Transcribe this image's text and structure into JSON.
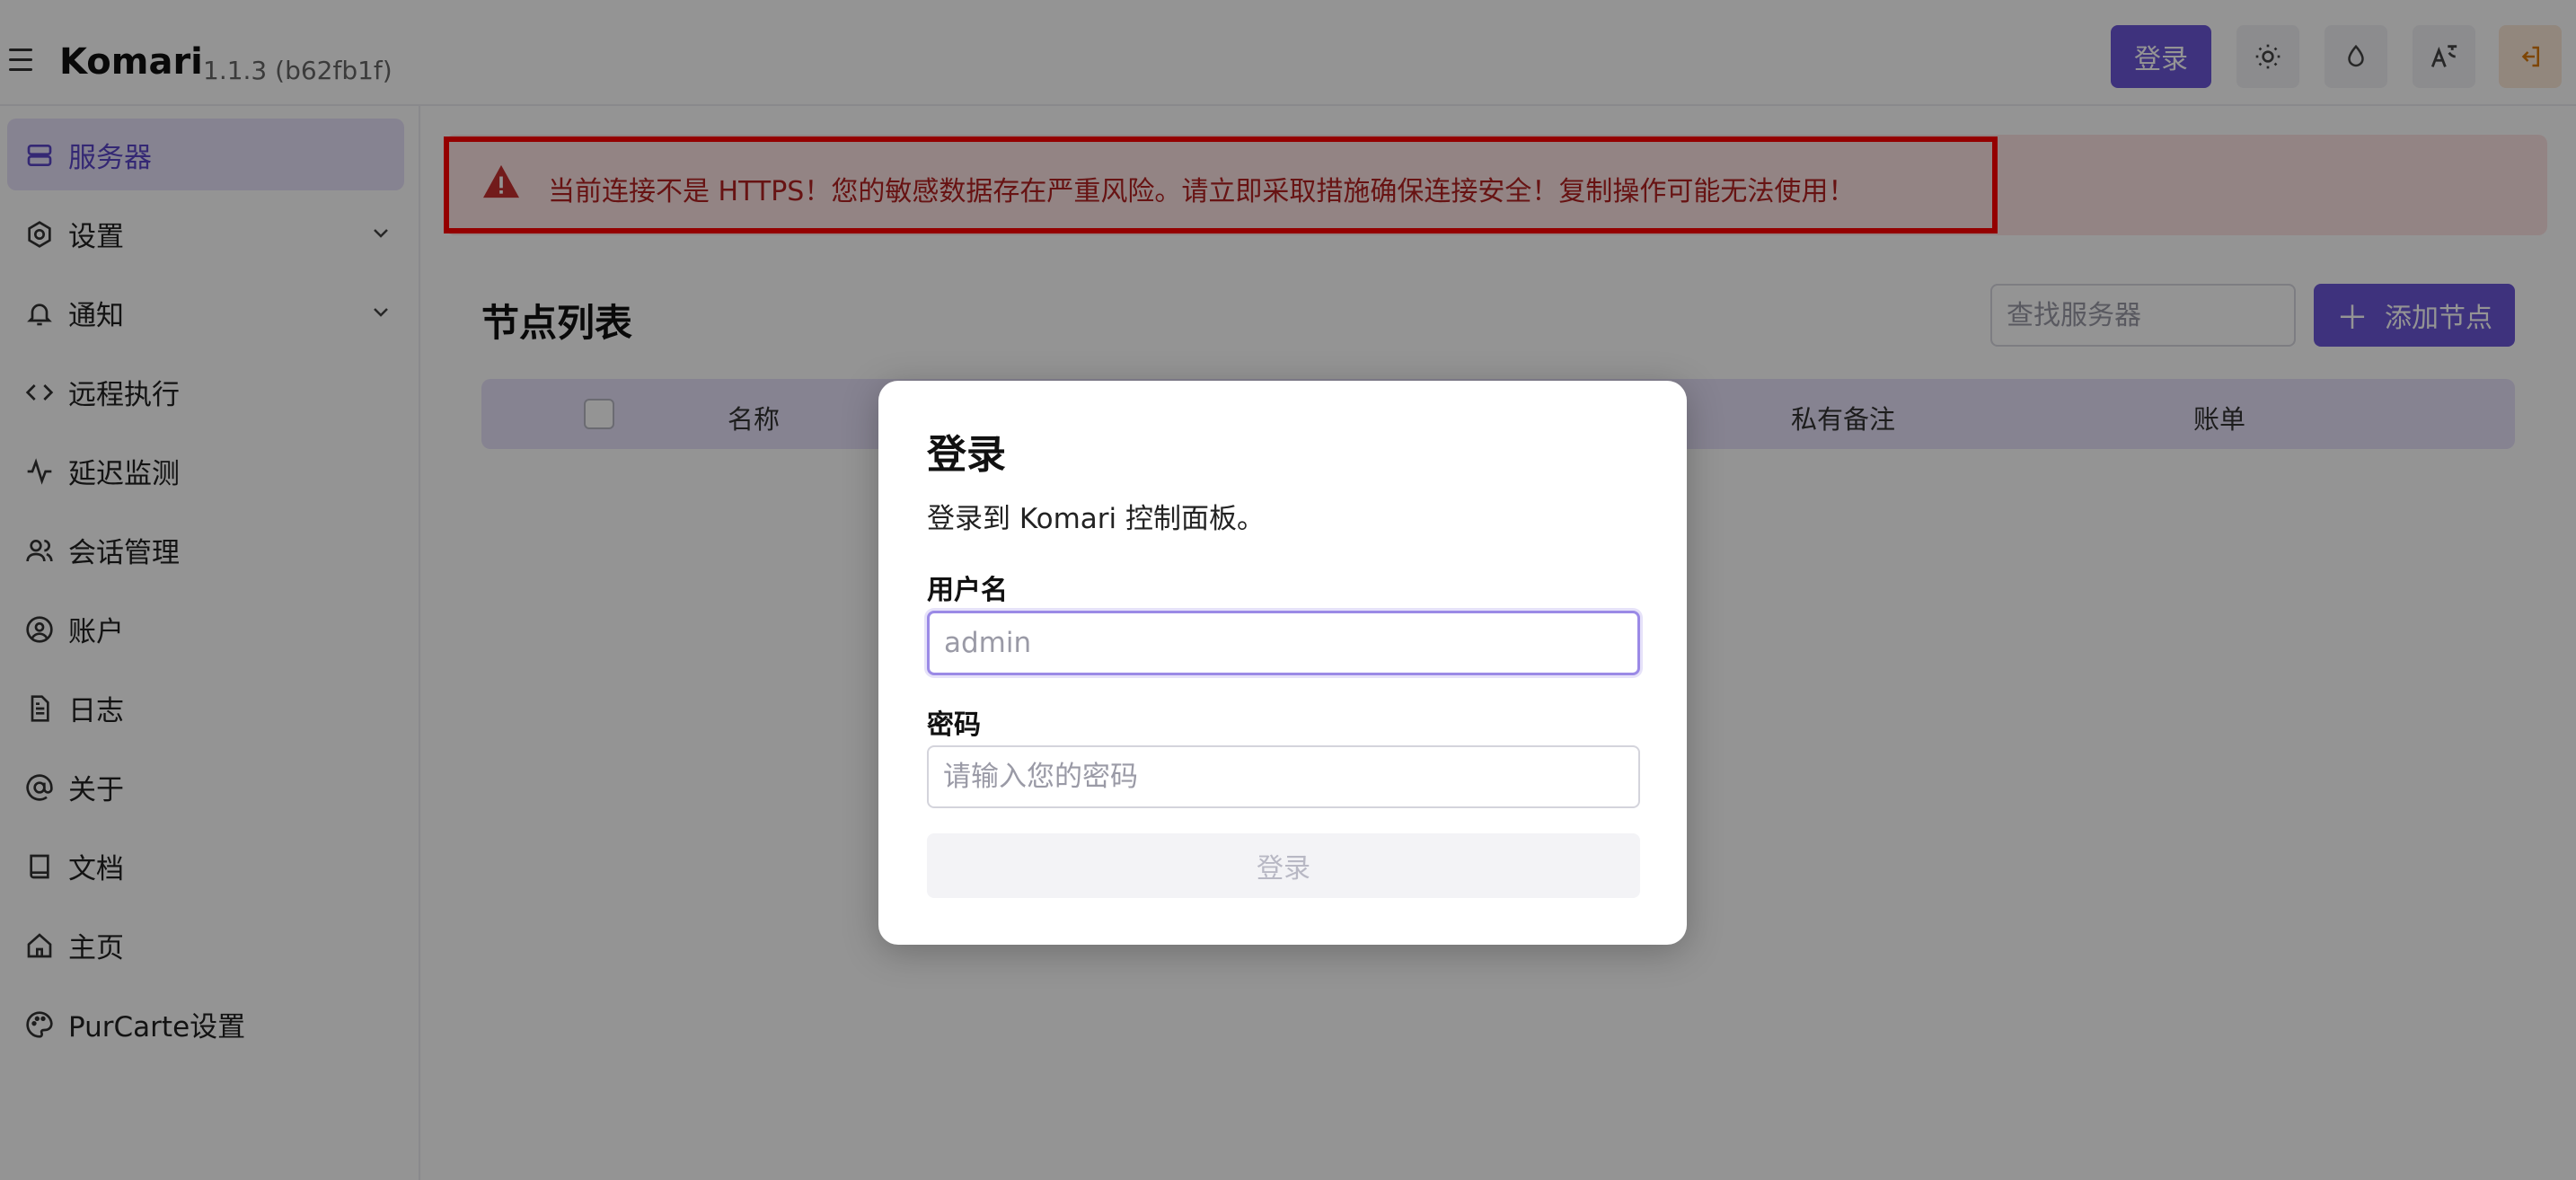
{
  "header": {
    "brand": "Komari",
    "version": "1.1.3 (b62fb1f)",
    "login_label": "登录"
  },
  "sidebar": {
    "items": [
      {
        "label": "服务器",
        "icon": "server-icon",
        "active": true
      },
      {
        "label": "设置",
        "icon": "settings-icon",
        "expandable": true
      },
      {
        "label": "通知",
        "icon": "bell-icon",
        "expandable": true
      },
      {
        "label": "远程执行",
        "icon": "code-icon"
      },
      {
        "label": "延迟监测",
        "icon": "pulse-icon"
      },
      {
        "label": "会话管理",
        "icon": "users-icon"
      },
      {
        "label": "账户",
        "icon": "user-circle-icon"
      },
      {
        "label": "日志",
        "icon": "file-icon"
      },
      {
        "label": "关于",
        "icon": "at-icon"
      },
      {
        "label": "文档",
        "icon": "book-icon"
      },
      {
        "label": "主页",
        "icon": "home-icon"
      },
      {
        "label": "PurCarte设置",
        "icon": "palette-icon"
      }
    ]
  },
  "alert": {
    "text": "当前连接不是 HTTPS！您的敏感数据存在严重风险。请立即采取措施确保连接安全！复制操作可能无法使用！"
  },
  "main": {
    "title": "节点列表",
    "search_placeholder": "查找服务器",
    "add_label": "添加节点",
    "columns": [
      "名称",
      "私有备注",
      "账单"
    ]
  },
  "dialog": {
    "title": "登录",
    "description": "登录到 Komari 控制面板。",
    "username_label": "用户名",
    "username_placeholder": "admin",
    "password_label": "密码",
    "password_placeholder": "请输入您的密码",
    "submit_label": "登录"
  },
  "colors": {
    "accent": "#6c56d8",
    "alert_bg": "#fde3e3",
    "alert_text": "#b22222",
    "highlight_outline": "#ff0000"
  }
}
